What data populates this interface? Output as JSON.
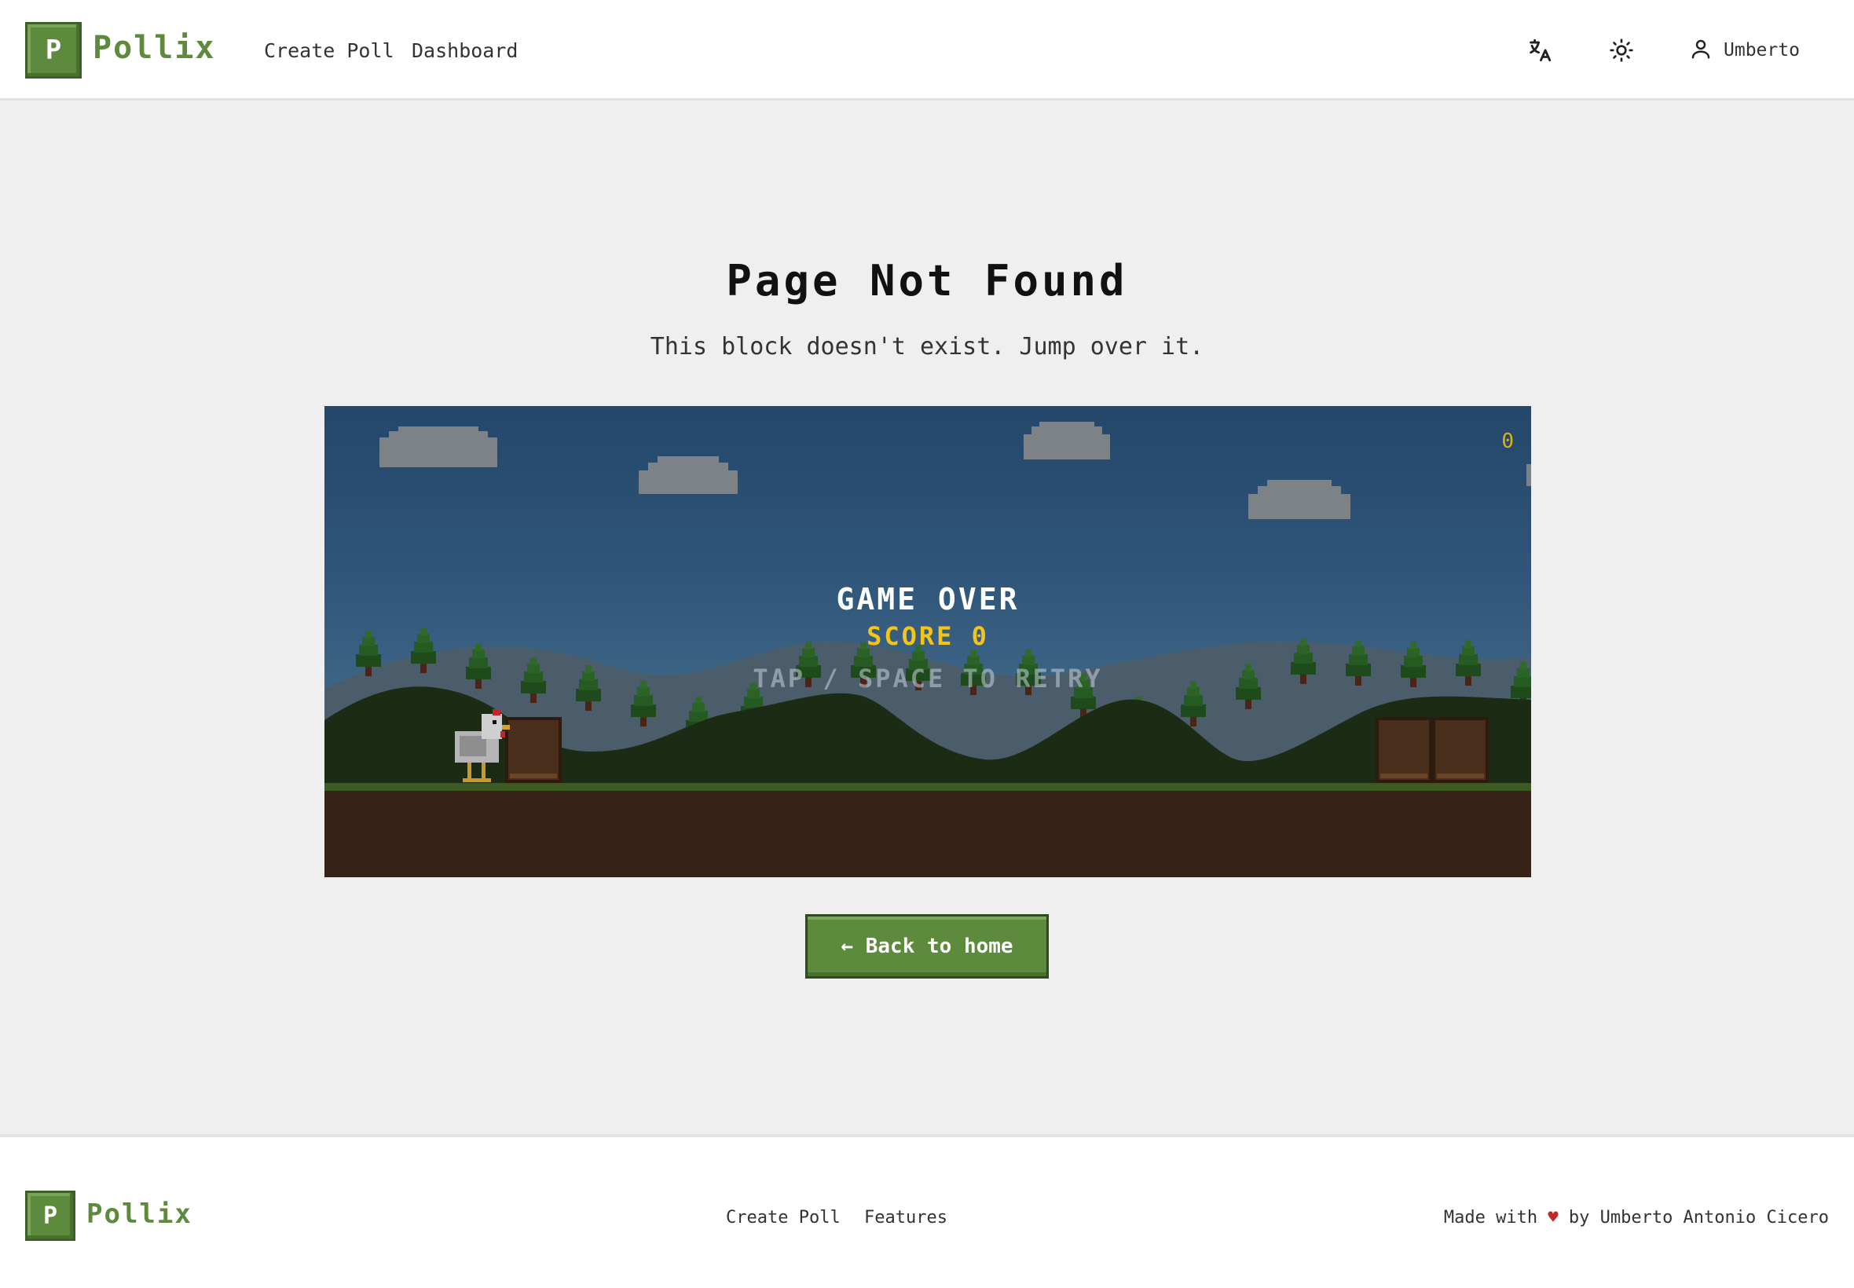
{
  "header": {
    "logo_letter": "P",
    "logo_text": "Pollix",
    "nav": {
      "create_poll": "Create Poll",
      "dashboard": "Dashboard"
    },
    "user_name": "Umberto"
  },
  "main": {
    "title": "Page Not Found",
    "subtitle": "This block doesn't exist. Jump over it.",
    "game": {
      "game_over": "GAME OVER",
      "score": "SCORE 0",
      "retry": "TAP / SPACE TO RETRY",
      "counter": "0"
    },
    "back_button": "← Back to home"
  },
  "footer": {
    "logo_letter": "P",
    "logo_text": "Pollix",
    "links": {
      "create_poll": "Create Poll",
      "features": "Features"
    },
    "credit_prefix": "Made with",
    "credit_heart": "♥",
    "credit_suffix": "by Umberto Antonio Cicero"
  },
  "colors": {
    "brand_green": "#5d8a3c",
    "score_yellow": "#f4c518",
    "heart_red": "#c0282c"
  },
  "icons": {
    "translate": "translate-icon",
    "theme": "sun-icon",
    "user": "user-icon"
  }
}
